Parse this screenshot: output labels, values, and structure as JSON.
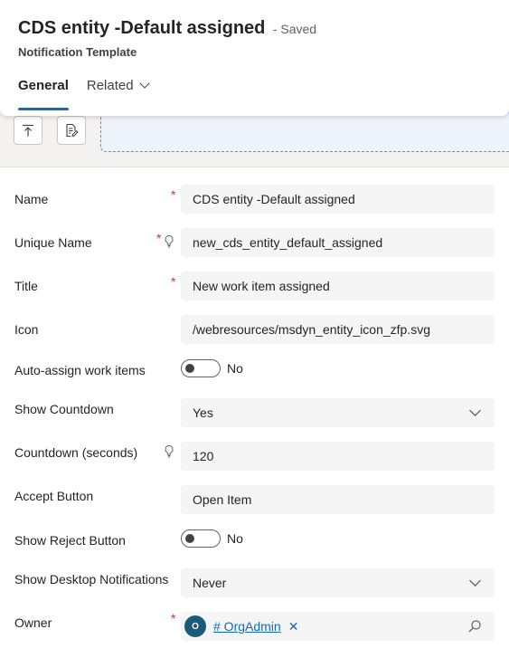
{
  "header": {
    "title": "CDS entity -Default assigned",
    "save_status": "- Saved",
    "entity_type": "Notification Template",
    "tabs": [
      {
        "label": "General",
        "active": true
      },
      {
        "label": "Related",
        "active": false
      }
    ]
  },
  "toolbar": {
    "buttons": [
      {
        "icon": "upload-arrow-icon"
      },
      {
        "icon": "edit-document-icon"
      }
    ]
  },
  "form": {
    "name": {
      "label": "Name",
      "required": "*",
      "value": "CDS entity -Default assigned"
    },
    "unique_name": {
      "label": "Unique Name",
      "required": "*",
      "value": "new_cds_entity_default_assigned"
    },
    "title": {
      "label": "Title",
      "required": "*",
      "value": "New work item assigned"
    },
    "icon": {
      "label": "Icon",
      "value": "/webresources/msdyn_entity_icon_zfp.svg"
    },
    "auto_assign": {
      "label": "Auto-assign work items",
      "value": "No"
    },
    "show_countdown": {
      "label": "Show Countdown",
      "value": "Yes"
    },
    "countdown": {
      "label": "Countdown (seconds)",
      "value": "120"
    },
    "accept_button": {
      "label": "Accept Button",
      "value": "Open Item"
    },
    "show_reject": {
      "label": "Show Reject Button",
      "value": "No"
    },
    "desktop_notifications": {
      "label": "Show Desktop Notifications",
      "value": "Never"
    },
    "owner": {
      "label": "Owner",
      "required": "*",
      "avatar_initial": "O",
      "value": "# OrgAdmin",
      "remove": "✕"
    }
  },
  "colors": {
    "accent": "#0f6cbd",
    "required": "#c4314b",
    "avatar": "#1a5b7a"
  }
}
